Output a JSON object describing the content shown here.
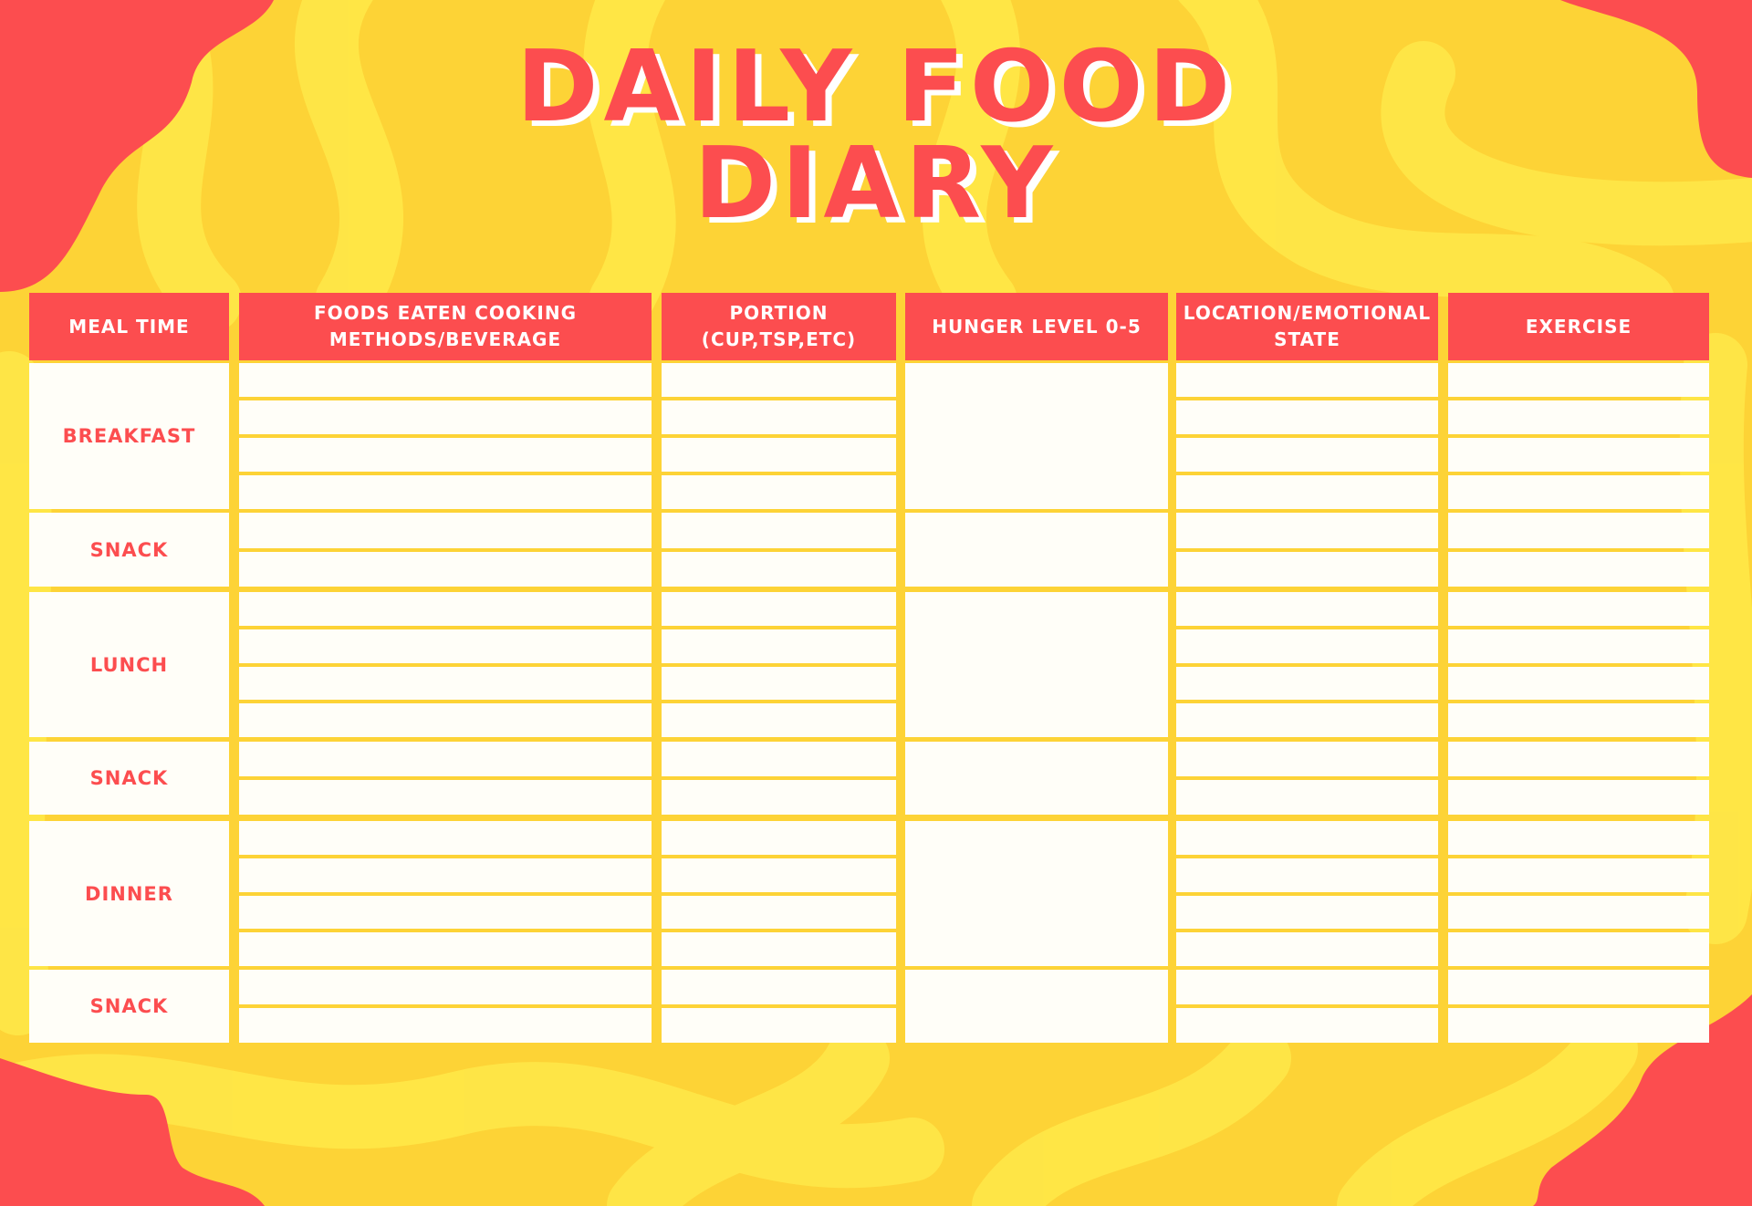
{
  "title": {
    "line1": "DAILY FOOD",
    "line2": "DIARY"
  },
  "colors": {
    "accent_red": "#fc4d4f",
    "yellow_dark": "#fdd336",
    "yellow_light": "#ffe747",
    "cell_white": "#fffef8"
  },
  "table": {
    "headers": [
      "MEAL TIME",
      "FOODS EATEN COOKING METHODS/BEVERAGE",
      "PORTION (CUP,TSP,ETC)",
      "HUNGER LEVEL 0-5",
      "LOCATION/EMOTIONAL STATE",
      "EXERCISE"
    ],
    "meals": [
      {
        "label": "BREAKFAST",
        "lines": 4
      },
      {
        "label": "SNACK",
        "lines": 2
      },
      {
        "label": "LUNCH",
        "lines": 4
      },
      {
        "label": "SNACK",
        "lines": 2
      },
      {
        "label": "DINNER",
        "lines": 4
      },
      {
        "label": "SNACK",
        "lines": 2
      }
    ]
  }
}
